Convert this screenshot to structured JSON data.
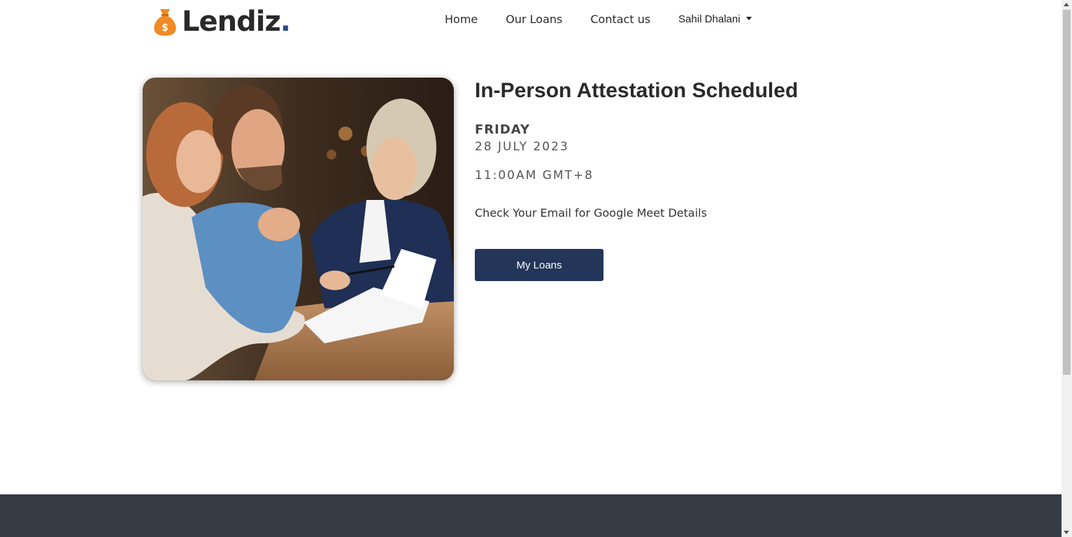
{
  "nav": {
    "brand_name": "Lendiz",
    "brand_dot": ".",
    "links": [
      "Home",
      "Our Loans",
      "Contact us"
    ],
    "user_name": "Sahil Dhalani"
  },
  "main": {
    "title": "In-Person Attestation Scheduled",
    "day": "FRIDAY",
    "date": "28 JULY 2023",
    "time": "11:00AM GMT+8",
    "note": "Check Your Email for Google Meet Details",
    "button_label": "My Loans"
  },
  "colors": {
    "accent": "#233559",
    "footer": "#363c44",
    "logo_bag": "#f08a24"
  },
  "icons": {
    "logo": "money-bag-icon",
    "dropdown": "caret-down-icon"
  }
}
